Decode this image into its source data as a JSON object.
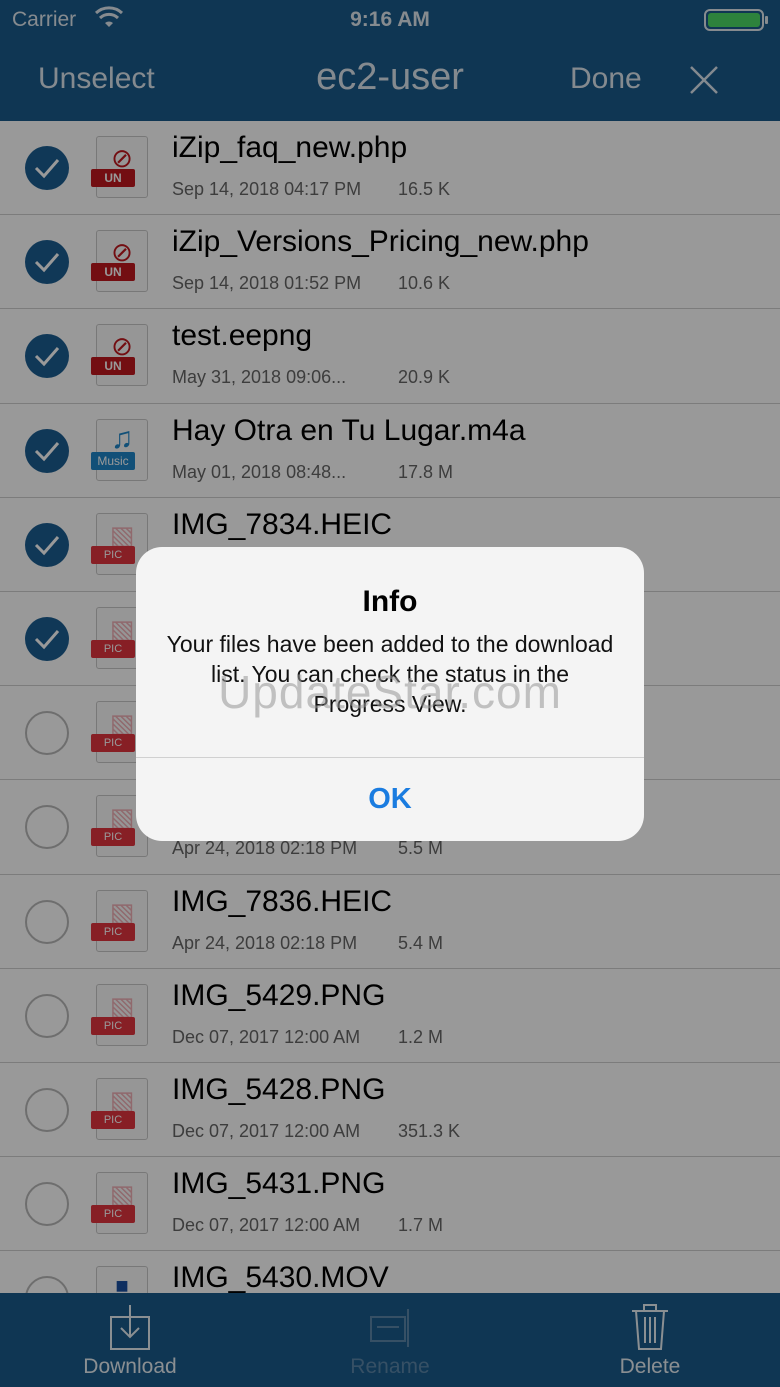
{
  "status": {
    "carrier": "Carrier",
    "time": "9:16 AM"
  },
  "nav": {
    "left": "Unselect",
    "title": "ec2-user",
    "done": "Done"
  },
  "files": [
    {
      "name": "iZip_faq_new.php",
      "date": "Sep 14, 2018 04:17 PM",
      "size": "16.5 K",
      "type": "un",
      "tag": "UN",
      "selected": true
    },
    {
      "name": "iZip_Versions_Pricing_new.php",
      "date": "Sep 14, 2018 01:52 PM",
      "size": "10.6 K",
      "type": "un",
      "tag": "UN",
      "selected": true
    },
    {
      "name": "test.eepng",
      "date": "May 31, 2018 09:06...",
      "size": "20.9 K",
      "type": "un",
      "tag": "UN",
      "selected": true
    },
    {
      "name": "Hay Otra en Tu Lugar.m4a",
      "date": "May 01, 2018 08:48...",
      "size": "17.8 M",
      "type": "music",
      "tag": "Music",
      "selected": true
    },
    {
      "name": "IMG_7834.HEIC",
      "date": "",
      "size": "",
      "type": "pic",
      "tag": "PIC",
      "selected": true
    },
    {
      "name": "",
      "date": "",
      "size": "",
      "type": "pic",
      "tag": "PIC",
      "selected": true
    },
    {
      "name": "",
      "date": "",
      "size": "",
      "type": "pic",
      "tag": "PIC",
      "selected": false
    },
    {
      "name": "",
      "date": "Apr 24, 2018 02:18 PM",
      "size": "5.5 M",
      "type": "pic",
      "tag": "PIC",
      "selected": false
    },
    {
      "name": "IMG_7836.HEIC",
      "date": "Apr 24, 2018 02:18 PM",
      "size": "5.4 M",
      "type": "pic",
      "tag": "PIC",
      "selected": false
    },
    {
      "name": "IMG_5429.PNG",
      "date": "Dec 07, 2017 12:00 AM",
      "size": "1.2 M",
      "type": "pic",
      "tag": "PIC",
      "selected": false
    },
    {
      "name": "IMG_5428.PNG",
      "date": "Dec 07, 2017 12:00 AM",
      "size": "351.3 K",
      "type": "pic",
      "tag": "PIC",
      "selected": false
    },
    {
      "name": "IMG_5431.PNG",
      "date": "Dec 07, 2017 12:00 AM",
      "size": "1.7 M",
      "type": "pic",
      "tag": "PIC",
      "selected": false
    },
    {
      "name": "IMG_5430.MOV",
      "date": "",
      "size": "",
      "type": "mov",
      "tag": "",
      "selected": false
    }
  ],
  "toolbar": {
    "download": "Download",
    "rename": "Rename",
    "delete": "Delete"
  },
  "alert": {
    "title": "Info",
    "message": "Your files have been added to the download list. You can check the status in the Progress View.",
    "ok": "OK"
  },
  "watermark": "UpdateStar.com",
  "colors": {
    "bar": "#1a5a8a",
    "accent": "#1c5e92",
    "tag_un": "#c0181e",
    "tag_pic": "#e2343f",
    "tag_music": "#1f86c9",
    "ok_blue": "#1a7ce0"
  }
}
